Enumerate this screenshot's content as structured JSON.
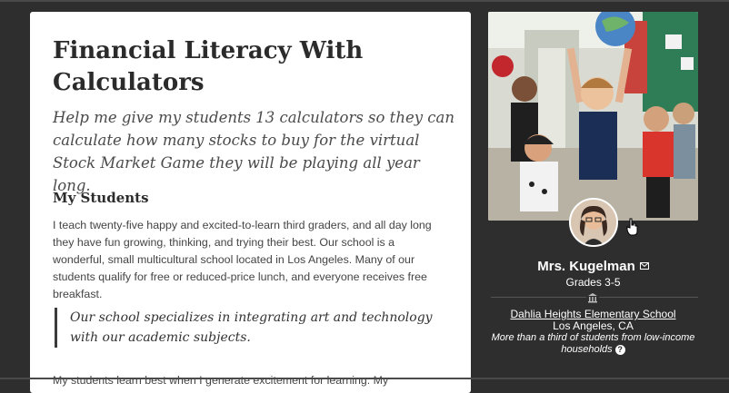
{
  "project": {
    "title": "Financial Literacy With Calculators",
    "subtitle": "Help me give my students 13 calculators so they can calculate how many stocks to buy for the virtual Stock Market Game they will be playing all year long.",
    "section_heading": "My Students",
    "paragraph": "I teach twenty-five happy and excited-to-learn third graders, and all day long they have fun growing, thinking, and trying their best. Our school is a wonderful, small multicultural school located in Los Angeles. Many of our students qualify for free or reduced-price lunch, and everyone receives free breakfast.",
    "quote": "Our school specializes in integrating art and technology with our academic subjects.",
    "paragraph2": "My students learn best when I generate excitement for learning. My"
  },
  "teacher": {
    "name": "Mrs. Kugelman",
    "grades": "Grades 3-5",
    "school": "Dahlia Heights Elementary School",
    "location": "Los Angeles, CA",
    "poverty_note": "More than a third of students from low-income households",
    "help_symbol": "?"
  },
  "icons": {
    "mail": "mail-icon",
    "school": "school-building-icon",
    "help": "help-icon",
    "cursor": "hand-cursor-icon"
  },
  "colors": {
    "background": "#2e2e2e",
    "card": "#ffffff",
    "title": "#2b2b2b"
  }
}
